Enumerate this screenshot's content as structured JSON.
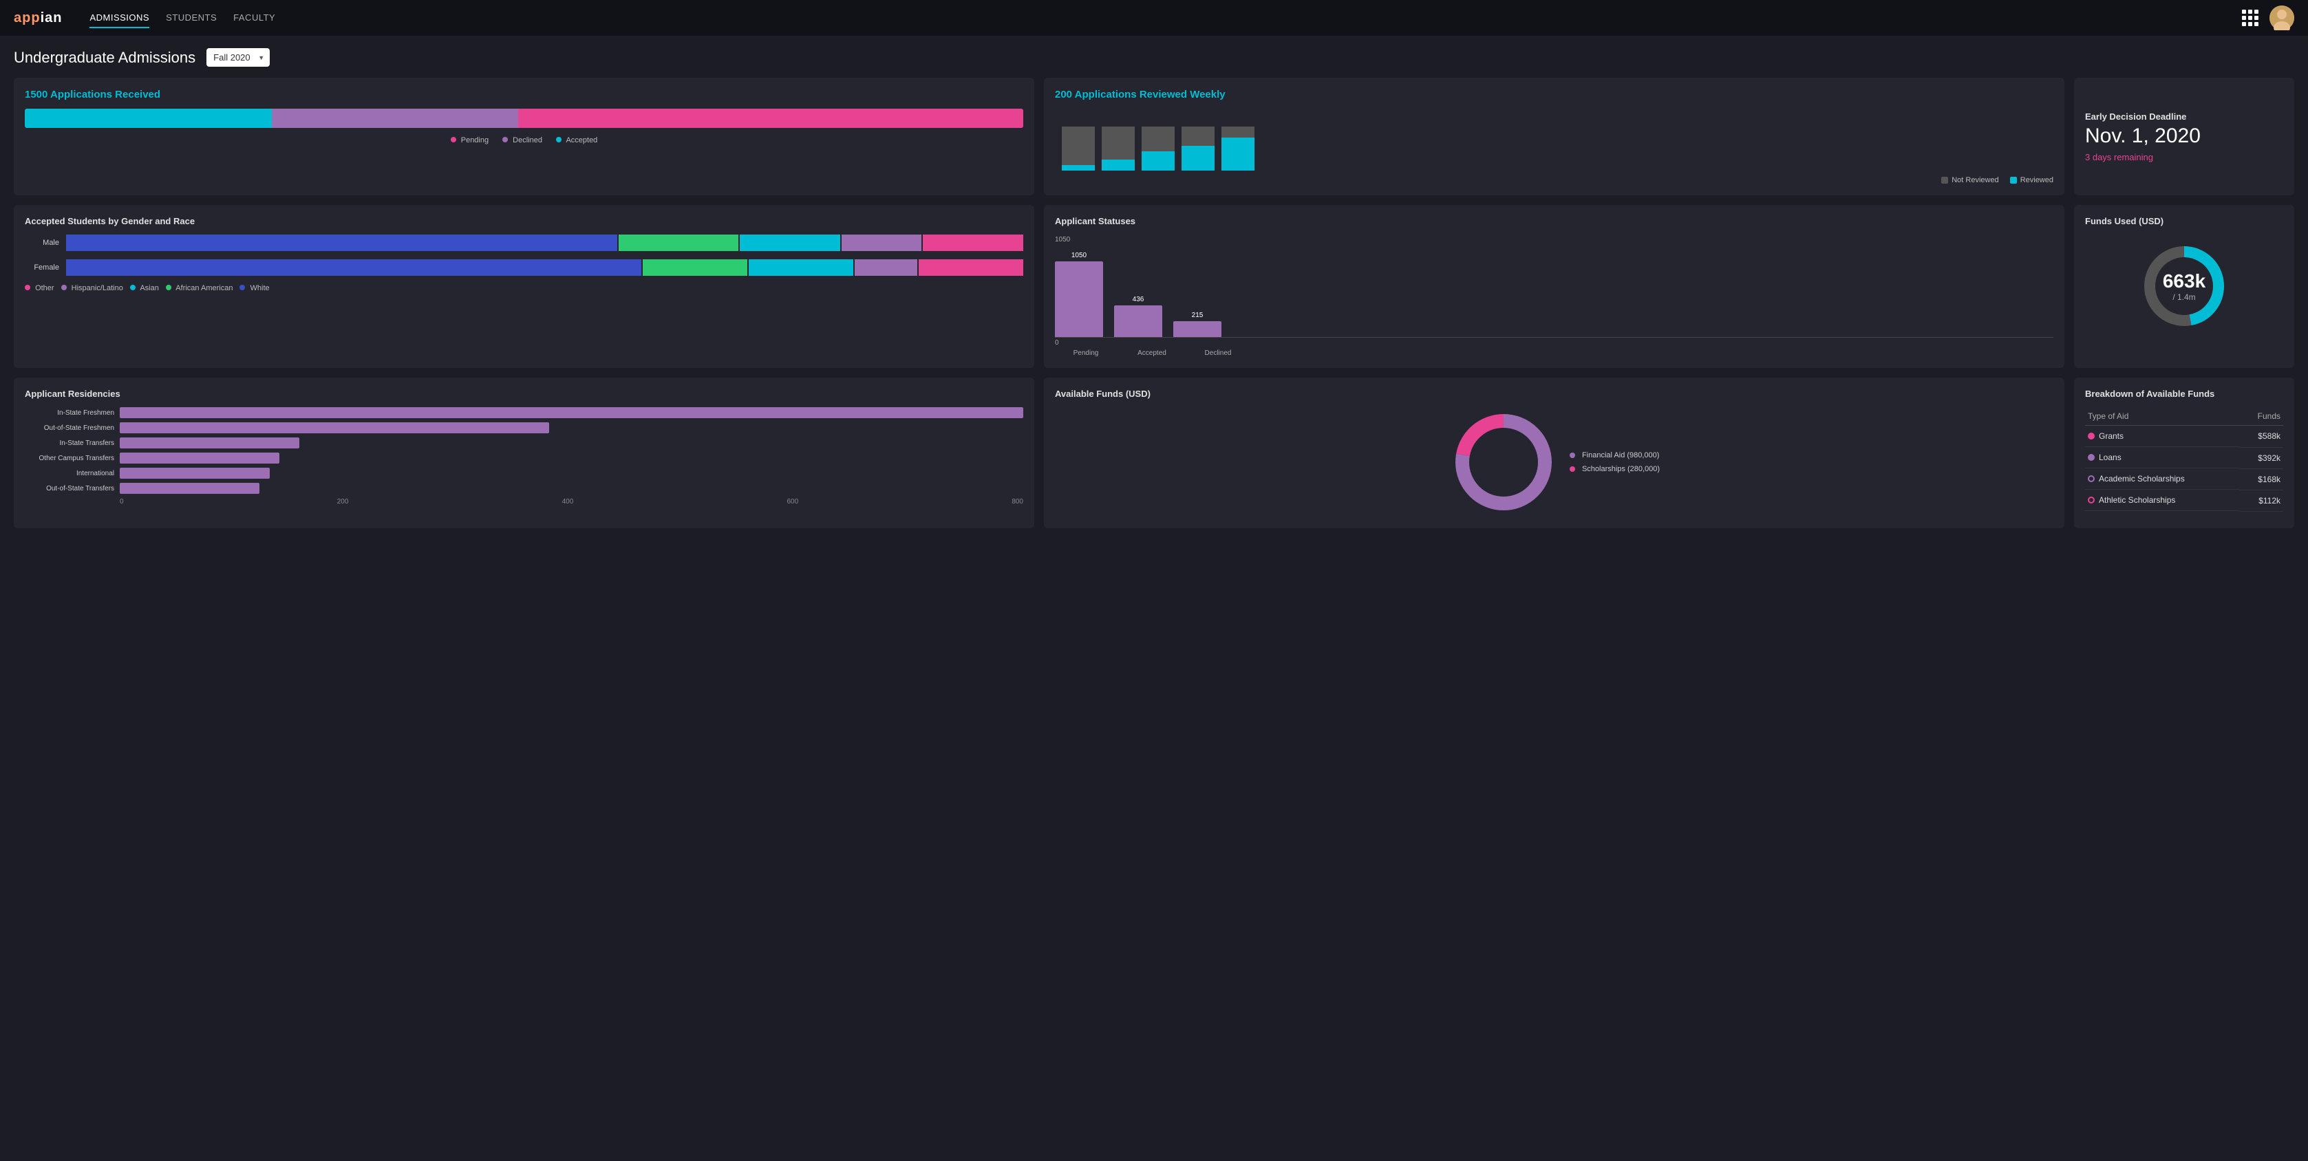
{
  "nav": {
    "logo": "appian",
    "links": [
      "ADMISSIONS",
      "STUDENTS",
      "FACULTY"
    ],
    "active_link": "ADMISSIONS"
  },
  "page": {
    "title": "Undergraduate Admissions",
    "semester": "Fall 2020"
  },
  "applications_received": {
    "card_title": "Applications Received",
    "count": "1500",
    "label": "Applications Received",
    "bar_legend": [
      {
        "label": "Pending",
        "color": "#e84393"
      },
      {
        "label": "Declined",
        "color": "#9c6fb5"
      },
      {
        "label": "Accepted",
        "color": "#00bcd4"
      }
    ]
  },
  "weekly_review": {
    "count": "200",
    "label": "Applications Reviewed Weekly",
    "legend_not_reviewed": "Not Reviewed",
    "legend_reviewed": "Reviewed",
    "bars": [
      {
        "not_reviewed": 70,
        "reviewed": 10
      },
      {
        "not_reviewed": 60,
        "reviewed": 20
      },
      {
        "not_reviewed": 45,
        "reviewed": 35
      },
      {
        "not_reviewed": 35,
        "reviewed": 45
      },
      {
        "not_reviewed": 20,
        "reviewed": 60
      }
    ]
  },
  "deadline": {
    "label": "Early Decision Deadline",
    "date": "Nov. 1, 2020",
    "remaining": "3 days remaining"
  },
  "gender_race": {
    "title": "Accepted Students by Gender and Race",
    "rows": [
      {
        "label": "Male",
        "segments": [
          {
            "color": "#3a4fc7",
            "flex": 5.5
          },
          {
            "color": "#2ecc71",
            "flex": 1.2
          },
          {
            "color": "#00bcd4",
            "flex": 1.0
          },
          {
            "color": "#9c6fb5",
            "flex": 0.8
          },
          {
            "color": "#e84393",
            "flex": 1.0
          }
        ]
      },
      {
        "label": "Female",
        "segments": [
          {
            "color": "#3a4fc7",
            "flex": 5.5
          },
          {
            "color": "#2ecc71",
            "flex": 1.0
          },
          {
            "color": "#00bcd4",
            "flex": 1.0
          },
          {
            "color": "#9c6fb5",
            "flex": 0.6
          },
          {
            "color": "#e84393",
            "flex": 1.0
          }
        ]
      }
    ],
    "legend": [
      {
        "label": "Other",
        "color": "#e84393"
      },
      {
        "label": "Hispanic/Latino",
        "color": "#9c6fb5"
      },
      {
        "label": "Asian",
        "color": "#00bcd4"
      },
      {
        "label": "African American",
        "color": "#2ecc71"
      },
      {
        "label": "White",
        "color": "#3a4fc7"
      }
    ]
  },
  "applicant_statuses": {
    "title": "Applicant Statuses",
    "y_max": 1050,
    "bars": [
      {
        "label": "Pending",
        "value": 1050,
        "color": "#9c6fb5"
      },
      {
        "label": "Accepted",
        "value": 436,
        "color": "#9c6fb5"
      },
      {
        "label": "Declined",
        "value": 215,
        "color": "#9c6fb5"
      }
    ],
    "y_zero": "0"
  },
  "funds_used": {
    "title": "Funds Used (USD)",
    "value": "663k",
    "sub": "/ 1.4m",
    "donut_used_pct": 47,
    "color_used": "#00bcd4",
    "color_remaining": "#555"
  },
  "residencies": {
    "title": "Applicant Residencies",
    "bars": [
      {
        "label": "In-State Freshmen",
        "value": 820,
        "max": 900
      },
      {
        "label": "Out-of-State Freshmen",
        "value": 390,
        "max": 900
      },
      {
        "label": "In-State Transfers",
        "value": 160,
        "max": 900
      },
      {
        "label": "Other Campus Transfers",
        "value": 140,
        "max": 900
      },
      {
        "label": "International",
        "value": 130,
        "max": 900
      },
      {
        "label": "Out-of-State Transfers",
        "value": 120,
        "max": 900
      }
    ],
    "x_labels": [
      "0",
      "200",
      "400",
      "600",
      "800"
    ]
  },
  "available_funds": {
    "title": "Available Funds (USD)",
    "segments": [
      {
        "label": "Financial Aid (980,000)",
        "value": 980000,
        "color": "#9c6fb5"
      },
      {
        "label": "Scholarships (280,000)",
        "value": 280000,
        "color": "#e84393"
      }
    ]
  },
  "breakdown": {
    "title": "Breakdown of Available Funds",
    "col_type": "Type of Aid",
    "col_funds": "Funds",
    "rows": [
      {
        "label": "Grants",
        "value": "$588k",
        "dot_color": "#e84393",
        "dot_border": "#e84393"
      },
      {
        "label": "Loans",
        "value": "$392k",
        "dot_color": "#9c6fb5",
        "dot_border": "#9c6fb5"
      },
      {
        "label": "Academic Scholarships",
        "value": "$168k",
        "dot_color": "transparent",
        "dot_border": "#9c6fb5"
      },
      {
        "label": "Athletic Scholarships",
        "value": "$112k",
        "dot_color": "transparent",
        "dot_border": "#e84393"
      }
    ]
  }
}
